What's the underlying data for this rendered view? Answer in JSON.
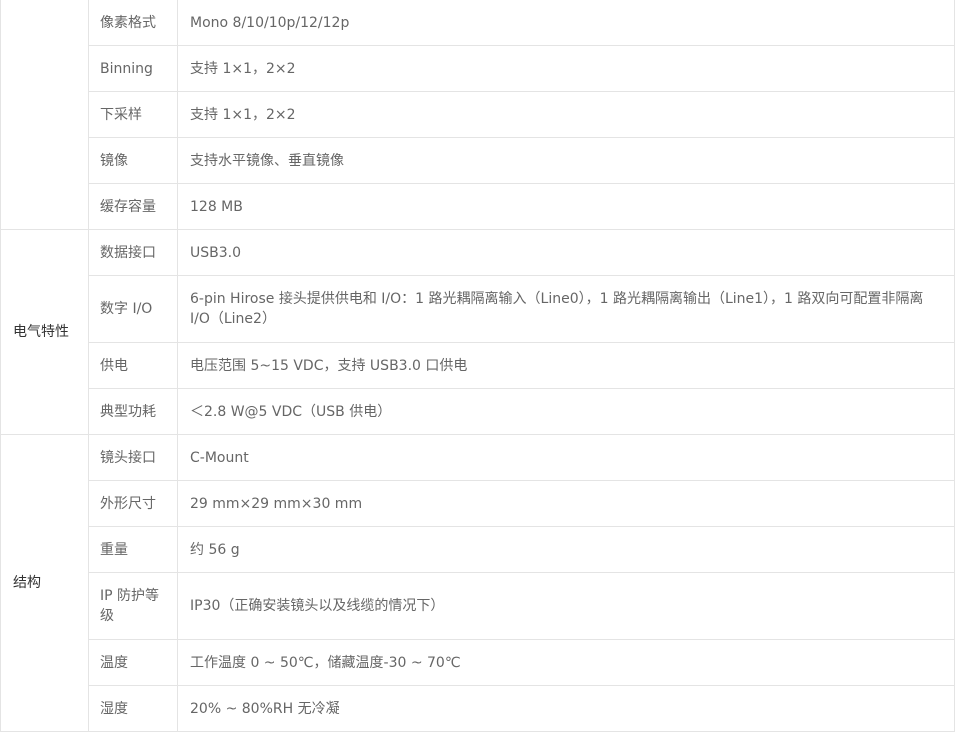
{
  "groups": [
    {
      "name": "",
      "rows": [
        {
          "label": "像素格式",
          "value": "Mono 8/10/10p/12/12p"
        },
        {
          "label": "Binning",
          "value": "支持 1×1，2×2"
        },
        {
          "label": "下采样",
          "value": "支持 1×1，2×2"
        },
        {
          "label": "镜像",
          "value": "支持水平镜像、垂直镜像"
        },
        {
          "label": "缓存容量",
          "value": "128 MB"
        }
      ]
    },
    {
      "name": "电气特性",
      "rows": [
        {
          "label": "数据接口",
          "value": "USB3.0"
        },
        {
          "label": "数字 I/O",
          "value": "6-pin Hirose 接头提供供电和 I/O：1 路光耦隔离输入（Line0），1 路光耦隔离输出（Line1），1 路双向可配置非隔离 I/O（Line2）"
        },
        {
          "label": "供电",
          "value": "电压范围 5~15 VDC，支持 USB3.0 口供电"
        },
        {
          "label": "典型功耗",
          "value": "＜2.8 W@5 VDC（USB 供电）"
        }
      ]
    },
    {
      "name": "结构",
      "rows": [
        {
          "label": "镜头接口",
          "value": "C-Mount"
        },
        {
          "label": "外形尺寸",
          "value": "29 mm×29 mm×30 mm"
        },
        {
          "label": "重量",
          "value": "约 56 g"
        },
        {
          "label": "IP 防护等级",
          "value": "IP30（正确安装镜头以及线缆的情况下）"
        },
        {
          "label": "温度",
          "value": "工作温度 0 ~ 50℃，储藏温度-30 ~ 70℃"
        },
        {
          "label": "湿度",
          "value": "20% ~ 80%RH 无冷凝"
        }
      ]
    }
  ]
}
